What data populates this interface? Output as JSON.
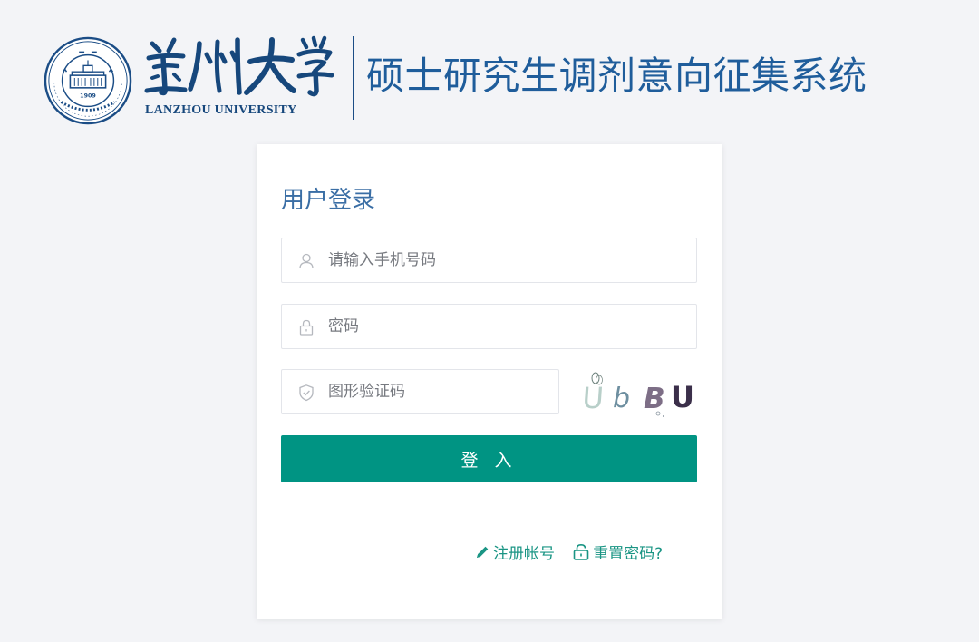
{
  "header": {
    "university_cn": "兰州大学",
    "university_en": "LANZHOU UNIVERSITY",
    "system_title": "硕士研究生调剂意向征集系统",
    "seal_year": "1909"
  },
  "login": {
    "title": "用户登录",
    "phone_placeholder": "请输入手机号码",
    "password_placeholder": "密码",
    "captcha_placeholder": "图形验证码",
    "captcha_text": "UbBU",
    "login_button": "登 入",
    "register_link": "注册帐号",
    "reset_link": "重置密码?"
  },
  "colors": {
    "accent": "#009483",
    "title_blue": "#1f5d9b",
    "brand_navy": "#16477c",
    "link_green": "#1a9584"
  },
  "icons": {
    "phone_field": "user-icon",
    "password_field": "lock-icon",
    "captcha_field": "shield-icon",
    "register": "pencil-icon",
    "reset": "unlock-icon"
  }
}
